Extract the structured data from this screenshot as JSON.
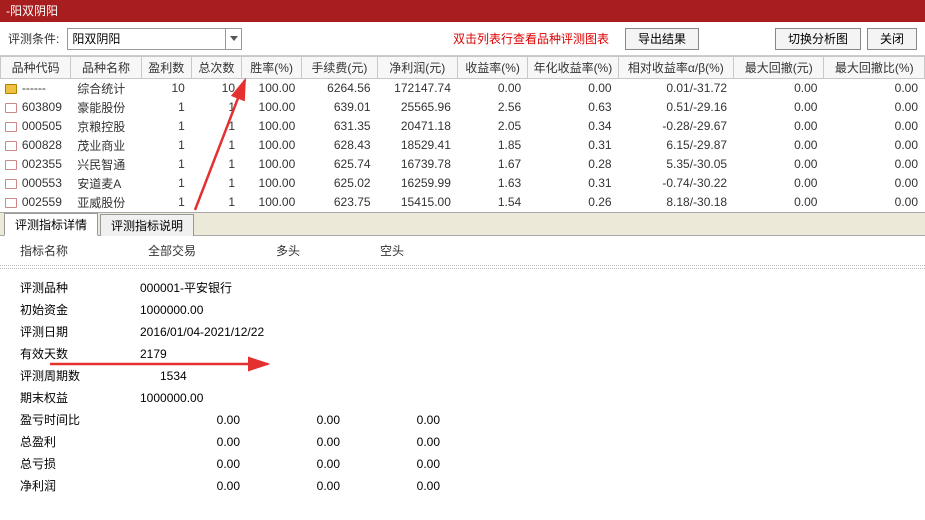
{
  "window": {
    "title": "-阳双阴阳"
  },
  "toolbar": {
    "condition_label": "评测条件:",
    "condition_value": "阳双阴阳",
    "hint": "双击列表行查看品种评测图表",
    "export_label": "导出结果",
    "switch_label": "切换分析图",
    "close_label": "关闭"
  },
  "columns": [
    "品种代码",
    "品种名称",
    "盈利数",
    "总次数",
    "胜率(%)",
    "手续费(元)",
    "净利润(元)",
    "收益率(%)",
    "年化收益率(%)",
    "相对收益率α/β(%)",
    "最大回撤(元)",
    "最大回撤比(%)"
  ],
  "rows": [
    {
      "code": "------",
      "name": "综合统计",
      "win": "10",
      "total": "10",
      "rate": "100.00",
      "fee": "6264.56",
      "profit": "172147.74",
      "ret": "0.00",
      "annual": "0.00",
      "rel": "0.01/-31.72",
      "dd": "0.00",
      "ddp": "0.00",
      "summary": true
    },
    {
      "code": "603809",
      "name": "豪能股份",
      "win": "1",
      "total": "1",
      "rate": "100.00",
      "fee": "639.01",
      "profit": "25565.96",
      "ret": "2.56",
      "annual": "0.63",
      "rel": "0.51/-29.16",
      "dd": "0.00",
      "ddp": "0.00"
    },
    {
      "code": "000505",
      "name": "京粮控股",
      "win": "1",
      "total": "1",
      "rate": "100.00",
      "fee": "631.35",
      "profit": "20471.18",
      "ret": "2.05",
      "annual": "0.34",
      "rel": "-0.28/-29.67",
      "dd": "0.00",
      "ddp": "0.00"
    },
    {
      "code": "600828",
      "name": "茂业商业",
      "win": "1",
      "total": "1",
      "rate": "100.00",
      "fee": "628.43",
      "profit": "18529.41",
      "ret": "1.85",
      "annual": "0.31",
      "rel": "6.15/-29.87",
      "dd": "0.00",
      "ddp": "0.00"
    },
    {
      "code": "002355",
      "name": "兴民智通",
      "win": "1",
      "total": "1",
      "rate": "100.00",
      "fee": "625.74",
      "profit": "16739.78",
      "ret": "1.67",
      "annual": "0.28",
      "rel": "5.35/-30.05",
      "dd": "0.00",
      "ddp": "0.00"
    },
    {
      "code": "000553",
      "name": "安道麦A",
      "win": "1",
      "total": "1",
      "rate": "100.00",
      "fee": "625.02",
      "profit": "16259.99",
      "ret": "1.63",
      "annual": "0.31",
      "rel": "-0.74/-30.22",
      "dd": "0.00",
      "ddp": "0.00"
    },
    {
      "code": "002559",
      "name": "亚威股份",
      "win": "1",
      "total": "1",
      "rate": "100.00",
      "fee": "623.75",
      "profit": "15415.00",
      "ret": "1.54",
      "annual": "0.26",
      "rel": "8.18/-30.18",
      "dd": "0.00",
      "ddp": "0.00"
    }
  ],
  "tabs": {
    "detail": "评测指标详情",
    "desc": "评测指标说明"
  },
  "detail_header": {
    "c0": "指标名称",
    "c1": "全部交易",
    "c2": "多头",
    "c3": "空头"
  },
  "details": {
    "product_label": "评测品种",
    "product_value": "000001-平安银行",
    "initcap_label": "初始资金",
    "initcap_value": "1000000.00",
    "date_label": "评测日期",
    "date_value": "2016/01/04-2021/12/22",
    "days_label": "有效天数",
    "days_value": "2179",
    "periods_label": "评测周期数",
    "periods_value": "1534",
    "endcap_label": "期末权益",
    "endcap_value": "1000000.00",
    "ratio_label": "盈亏时间比",
    "ratio_v1": "0.00",
    "ratio_v2": "0.00",
    "ratio_v3": "0.00",
    "gross_label": "总盈利",
    "gross_v1": "0.00",
    "gross_v2": "0.00",
    "gross_v3": "0.00",
    "loss_label": "总亏损",
    "loss_v1": "0.00",
    "loss_v2": "0.00",
    "loss_v3": "0.00",
    "net_label": "净利润",
    "net_v1": "0.00",
    "net_v2": "0.00",
    "net_v3": "0.00"
  }
}
